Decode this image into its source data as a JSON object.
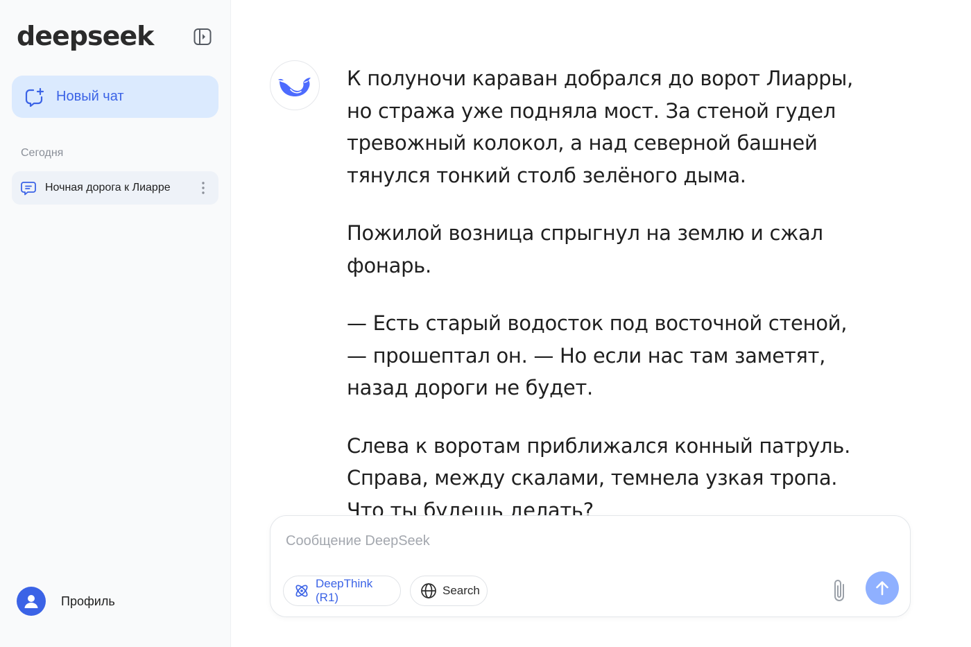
{
  "sidebar": {
    "logo": "deepseek",
    "new_chat_label": "Новый чат",
    "section_today": "Сегодня",
    "history": [
      {
        "title": "Ночная дорога к Лиарре"
      }
    ],
    "profile_label": "Профиль"
  },
  "chat": {
    "paragraphs": [
      "К полуночи караван добрался до ворот Лиарры, но стража уже подняла мост. За стеной гудел тревожный колокол, а над северной башней тянулся тонкий столб зелёного дыма.",
      "Пожилой возница спрыгнул на землю и сжал фонарь.",
      "— Есть старый водосток под восточной стеной, — прошептал он. — Но если нас там заметят, назад дороги не будет.",
      "Слева к воротам приближался конный патруль. Справа, между скалами, темнела узкая тропа. Что ты будешь делать?"
    ]
  },
  "composer": {
    "placeholder": "Сообщение DeepSeek",
    "value": "",
    "deepthink_label": "DeepThink (R1)",
    "search_label": "Search"
  },
  "icons": {
    "collapse": "sidebar-toggle-icon",
    "new_chat": "chat-plus-icon",
    "history": "chat-bubble-icon",
    "more": "more-vertical-icon",
    "avatar": "user-icon",
    "bot": "whale-icon",
    "deepthink": "atom-icon",
    "search": "globe-icon",
    "attach": "paperclip-icon",
    "send": "arrow-up-icon"
  },
  "colors": {
    "accent": "#3b63e6",
    "new_chat_bg": "#dbeafe",
    "sidebar_bg": "#f9fafb",
    "send_bg": "#8fb0ff"
  }
}
